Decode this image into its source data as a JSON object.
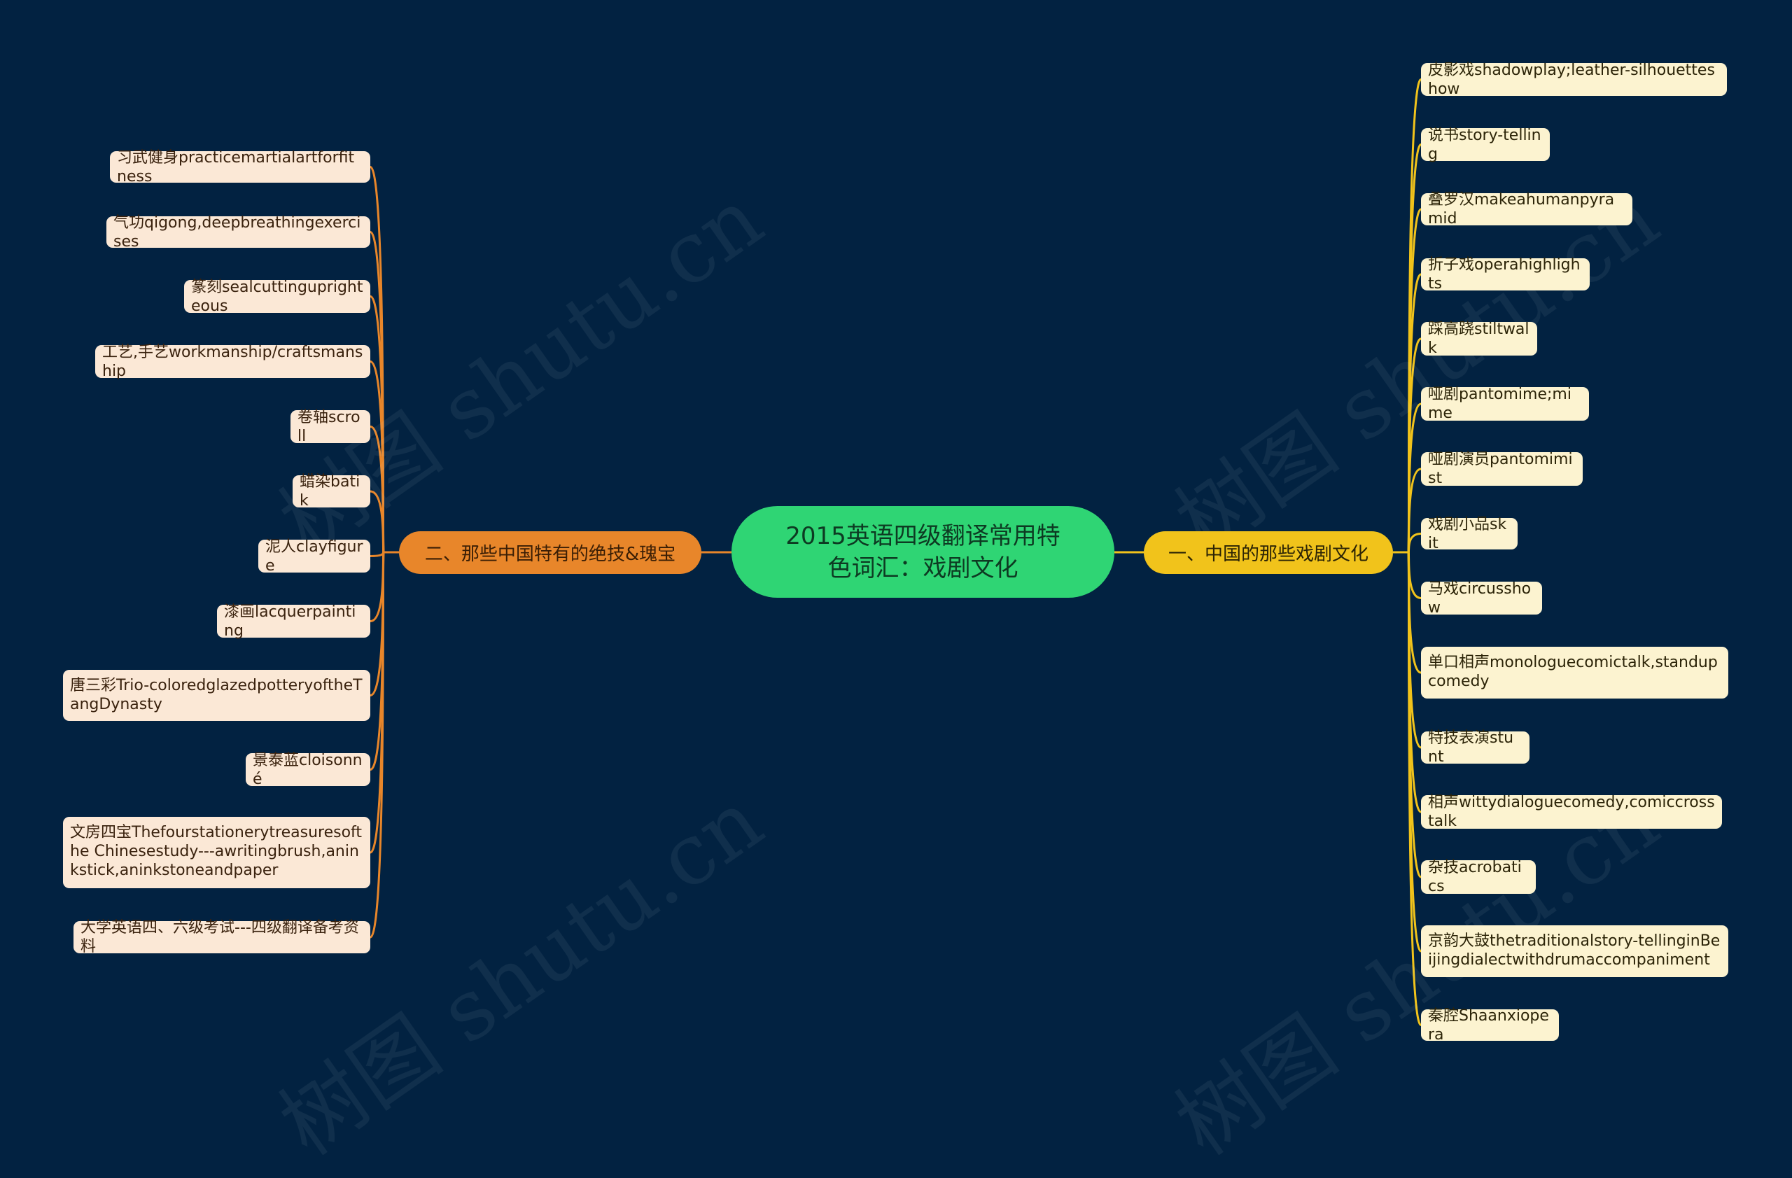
{
  "watermark": "树图 shutu.cn",
  "colors": {
    "background": "#022241",
    "root": "#2fd574",
    "branch_left": "#e8862a",
    "branch_right": "#f1c31b",
    "leaf_left": "#fbe8d6",
    "leaf_right": "#fcf3d0"
  },
  "root": {
    "title": "2015英语四级翻译常用特色词汇：戏剧文化"
  },
  "branches": {
    "right": {
      "label": "一、中国的那些戏剧文化",
      "items": [
        "皮影戏shadowplay;leather-silhouetteshow",
        "说书story-telling",
        "叠罗汉makeahumanpyramid",
        "折子戏operahighlights",
        "踩高跷stiltwalk",
        "哑剧pantomime;mime",
        "哑剧演员pantomimist",
        "戏剧小品skit",
        "马戏circusshow",
        "单口相声monologuecomictalk,standupcomedy",
        "特技表演stunt",
        "相声wittydialoguecomedy,comiccrosstalk",
        "杂技acrobatics",
        "京韵大鼓thetraditionalstory-tellinginBeijingdialectwithdrumaccompaniment",
        "秦腔Shaanxiopera"
      ]
    },
    "left": {
      "label": "二、那些中国特有的绝技&瑰宝",
      "items": [
        "习武健身practicemartialartforfitness",
        "气功qigong,deepbreathingexercises",
        "篆刻sealcuttinguprighteous",
        "工艺,手艺workmanship/craftsmanship",
        "卷轴scroll",
        "蜡染batik",
        "泥人clayfigure",
        "漆画lacquerpainting",
        "唐三彩Trio-coloredglazedpotteryoftheTangDynasty",
        "景泰蓝cloisonné",
        "文房四宝Thefourstationerytreasuresofthe Chinesestudy---awritingbrush,aninkstick,aninkstoneandpaper",
        "大学英语四、六级考试---四级翻译备考资料"
      ]
    }
  }
}
